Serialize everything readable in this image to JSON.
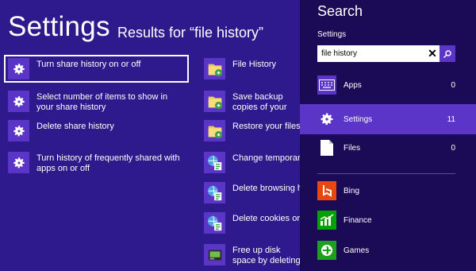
{
  "header": {
    "title": "Settings",
    "subtitle": "Results for “file history”"
  },
  "results_col1": [
    {
      "label": "Turn share history on or off",
      "icon": "gear-icon",
      "selected": true
    },
    {
      "label": "Select number of items to show in your share history",
      "icon": "gear-icon"
    },
    {
      "label": "Delete share history",
      "icon": "gear-icon"
    },
    {
      "label": "Turn history of frequently shared with apps on or off",
      "icon": "gear-icon"
    }
  ],
  "results_col2": [
    {
      "label": "File History",
      "icon": "file-history-icon"
    },
    {
      "label": "Save backup copies of your files with File History",
      "icon": "file-history-icon"
    },
    {
      "label": "Restore your files with File History",
      "icon": "file-history-icon"
    },
    {
      "label": "Change temporary Internet file settings",
      "icon": "internet-options-icon"
    },
    {
      "label": "Delete browsing history",
      "icon": "internet-options-icon"
    },
    {
      "label": "Delete cookies or temporary files",
      "icon": "internet-options-icon"
    },
    {
      "label": "Free up disk space by deleting unnecessary files",
      "icon": "disk-cleanup-icon"
    }
  ],
  "search_panel": {
    "title": "Search",
    "scope": "Settings",
    "query": "file history",
    "categories": [
      {
        "label": "Apps",
        "count": "0",
        "icon": "keyboard-icon"
      },
      {
        "label": "Settings",
        "count": "11",
        "icon": "gear-icon",
        "selected": true
      },
      {
        "label": "Files",
        "count": "0",
        "icon": "file-icon"
      }
    ],
    "apps": [
      {
        "label": "Bing",
        "icon": "bing-icon",
        "color": "#e8470e"
      },
      {
        "label": "Finance",
        "icon": "finance-icon",
        "color": "#00a300"
      },
      {
        "label": "Games",
        "icon": "games-icon",
        "color": "#1ba11b"
      }
    ]
  },
  "colors": {
    "background": "#2e1a8c",
    "panel": "#1b0a55",
    "accent": "#5a35c8"
  }
}
